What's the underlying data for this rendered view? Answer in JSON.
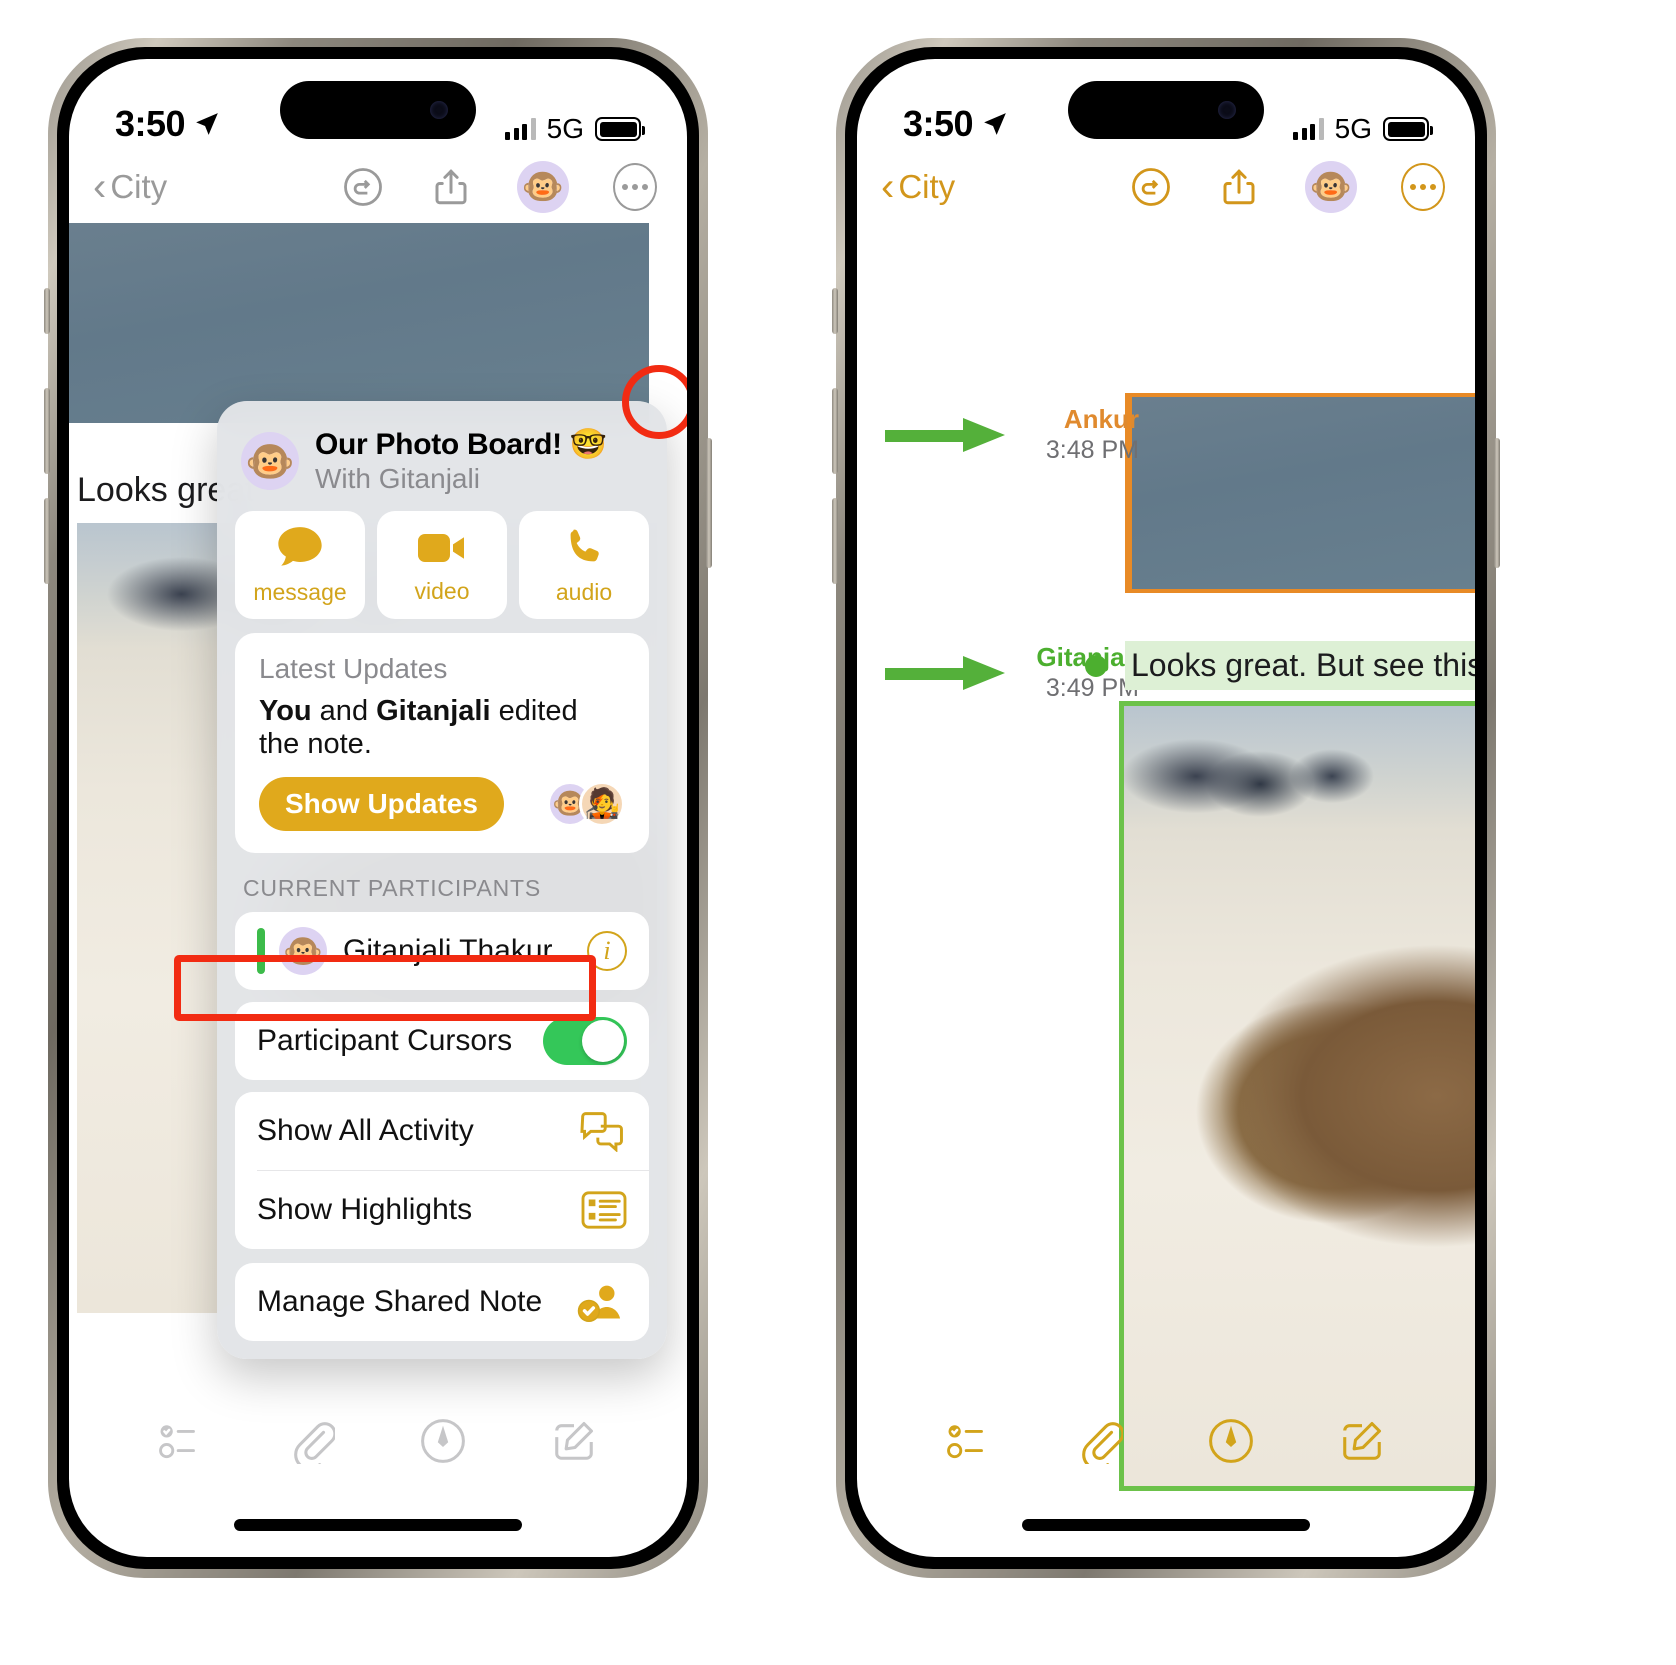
{
  "status_bar": {
    "time": "3:50",
    "network": "5G",
    "location_icon": "location-arrow-icon"
  },
  "left_phone": {
    "nav": {
      "back_label": "City",
      "icons": [
        "undo-icon",
        "share-icon",
        "collaborator-avatar-icon",
        "more-options-icon"
      ]
    },
    "note": {
      "text": "Looks great"
    },
    "popup": {
      "title": "Our Photo Board! 🤓",
      "subtitle": "With Gitanjali",
      "avatar_emoji": "🐵",
      "actions": [
        {
          "label": "message",
          "icon": "message-bubble-icon"
        },
        {
          "label": "video",
          "icon": "video-camera-icon"
        },
        {
          "label": "audio",
          "icon": "phone-handset-icon"
        }
      ],
      "updates": {
        "heading": "Latest Updates",
        "line_prefix": "You",
        "line_mid": " and ",
        "line_name": "Gitanjali",
        "line_suffix": " edited the note.",
        "button": "Show Updates",
        "faces": [
          "🐵",
          "🧑‍🎤"
        ]
      },
      "participants_header": "CURRENT PARTICIPANTS",
      "participant": {
        "name": "Gitanjali Thakur",
        "avatar_emoji": "🐵",
        "info_icon": "info-icon"
      },
      "toggle_row": {
        "label": "Participant Cursors",
        "state": "on"
      },
      "menu": [
        {
          "label": "Show All Activity",
          "icon": "activity-bubbles-icon",
          "highlighted": false
        },
        {
          "label": "Show Highlights",
          "icon": "highlights-list-icon",
          "highlighted": true
        }
      ],
      "manage_row": {
        "label": "Manage Shared Note",
        "icon": "manage-person-icon"
      }
    },
    "toolbar": [
      "checklist-icon",
      "paperclip-icon",
      "markup-pen-icon",
      "compose-icon"
    ]
  },
  "right_phone": {
    "nav": {
      "back_label": "City",
      "icons": [
        "undo-icon",
        "share-icon",
        "collaborator-avatar-icon",
        "more-options-icon"
      ]
    },
    "annotations": [
      {
        "name": "Ankur",
        "time": "3:48 PM",
        "color": "#e08a2e"
      },
      {
        "name": "Gitanjali",
        "time": "3:49 PM",
        "color": "#4caf2f"
      }
    ],
    "highlight_text": "Looks great. But see this:",
    "toolbar": [
      "checklist-icon",
      "paperclip-icon",
      "markup-pen-icon",
      "compose-icon"
    ]
  },
  "colors": {
    "accent_amber": "#d2a41b",
    "highlight_green": "#6cc24a",
    "highlight_green_bg": "#ddf0d5",
    "highlight_orange": "#e88a26",
    "callout_red": "#f22b12",
    "toggle_green": "#34c759"
  }
}
